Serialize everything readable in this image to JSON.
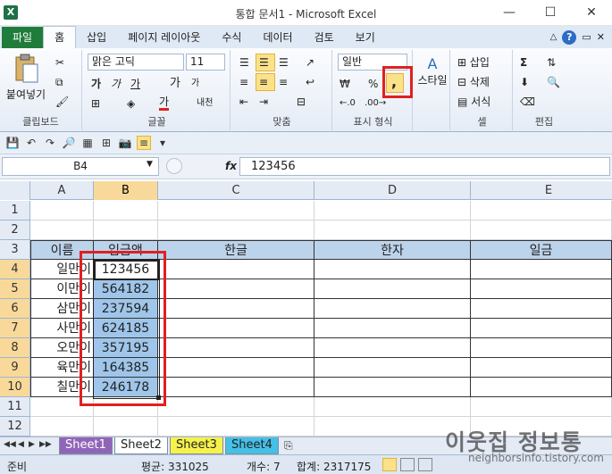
{
  "window": {
    "title": "통합 문서1 - Microsoft Excel",
    "minimize": "—",
    "maximize": "☐",
    "close": "✕"
  },
  "tabs": {
    "file": "파일",
    "home": "홈",
    "insert": "삽입",
    "layout": "페이지 레이아웃",
    "formulas": "수식",
    "data": "데이터",
    "review": "검토",
    "view": "보기"
  },
  "ribbon": {
    "paste": "붙여넣기",
    "clipboard_group": "클립보드",
    "font_name": "맑은 고딕",
    "font_size": "11",
    "bold": "가",
    "italic": "가",
    "underline": "가",
    "grow": "가",
    "shrink": "가",
    "phonetic": "내천",
    "font_color_label": "가",
    "font_group": "글꼴",
    "align_group": "맞춤",
    "number_format": "일반",
    "percent": "%",
    "comma": ",",
    "number_group": "표시 형식",
    "styles": "스타일",
    "insert_cells": "삽입",
    "delete_cells": "삭제",
    "format_cells": "서식",
    "cells_group": "셀",
    "editing_group": "편집",
    "autosum": "Σ"
  },
  "formula_bar": {
    "name_box": "B4",
    "fx": "fx",
    "content": "123456"
  },
  "columns": [
    {
      "id": "A"
    },
    {
      "id": "B"
    },
    {
      "id": "C"
    },
    {
      "id": "D"
    },
    {
      "id": "E"
    }
  ],
  "rows": [
    "1",
    "2",
    "3",
    "4",
    "5",
    "6",
    "7",
    "8",
    "9",
    "10",
    "11",
    "12"
  ],
  "headers": {
    "name": "이름",
    "amount": "입금액",
    "hangul": "한글",
    "hanja": "한자",
    "ilgeum": "일금"
  },
  "records": [
    {
      "name": "일만이",
      "amount": "123456"
    },
    {
      "name": "이만이",
      "amount": "564182"
    },
    {
      "name": "삼만이",
      "amount": "237594"
    },
    {
      "name": "사만이",
      "amount": "624185"
    },
    {
      "name": "오만이",
      "amount": "357195"
    },
    {
      "name": "육만이",
      "amount": "164385"
    },
    {
      "name": "칠만이",
      "amount": "246178"
    }
  ],
  "sheets": [
    "Sheet1",
    "Sheet2",
    "Sheet3",
    "Sheet4"
  ],
  "status": {
    "ready": "준비",
    "average": "평균: 331025",
    "count": "개수: 7",
    "sum": "합계: 2317175"
  },
  "watermark": {
    "main": "이웃집 정보통",
    "sub": "neighborsinfo.tistory.com"
  },
  "colors": {
    "selection": "#9fc6ea",
    "header_fill": "#bcd3ec",
    "highlight": "#e02020",
    "file_tab": "#1f7c3a"
  }
}
